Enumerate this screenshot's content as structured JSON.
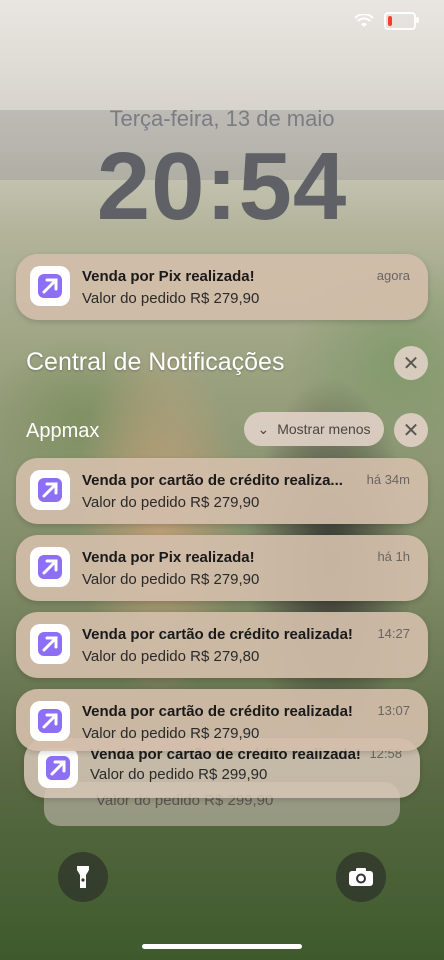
{
  "lock_screen": {
    "date": "Terça-feira, 13 de maio",
    "time": "20:54"
  },
  "top_notification": {
    "title": "Venda por Pix realizada!",
    "body": "Valor do pedido R$ 279,90",
    "time": "agora"
  },
  "notification_center": {
    "title": "Central de Notificações",
    "app_name": "Appmax",
    "show_less_label": "Mostrar menos"
  },
  "notifications": [
    {
      "title": "Venda por cartão de crédito realiza...",
      "body": "Valor do pedido R$ 279,90",
      "time": "há 34m"
    },
    {
      "title": "Venda por Pix realizada!",
      "body": "Valor do pedido R$ 279,90",
      "time": "há 1h"
    },
    {
      "title": "Venda por cartão de crédito realizada!",
      "body": "Valor do pedido R$ 279,80",
      "time": "14:27"
    },
    {
      "title": "Venda por cartão de crédito realizada!",
      "body": "Valor do pedido R$ 279,90",
      "time": "13:07"
    },
    {
      "title": "Venda por cartão de crédito realizada!",
      "body": "Valor do pedido R$ 299,90",
      "time": "12:58"
    }
  ],
  "stacked_partial": {
    "body": "Valor do pedido R$ 299,90"
  },
  "colors": {
    "card_bg": "#d2beaa",
    "icon_accent": "#7b5cf0"
  },
  "icons": {
    "app_icon": "appmax-arrow-icon",
    "close": "close-icon",
    "chevron": "chevron-down-icon",
    "flashlight": "flashlight-icon",
    "camera": "camera-icon"
  }
}
